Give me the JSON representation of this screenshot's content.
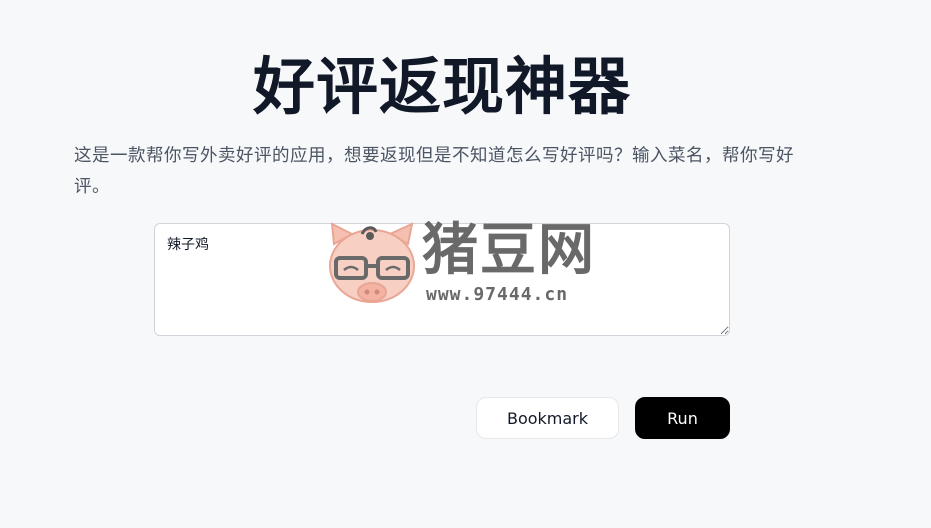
{
  "header": {
    "title": "好评返现神器"
  },
  "main": {
    "description": "这是一款帮你写外卖好评的应用，想要返现但是不知道怎么写好评吗？输入菜名，帮你写好评。",
    "dish_input": {
      "value": "辣子鸡"
    },
    "actions": {
      "bookmark_label": "Bookmark",
      "run_label": "Run"
    }
  },
  "watermark": {
    "brand_text": "猪豆网",
    "url_text": "www.97444.cn"
  },
  "colors": {
    "background": "#f7f8fa",
    "title": "#111827",
    "run_button": "#000000",
    "watermark_pig": "#f4b8a8",
    "watermark_text": "#555555"
  }
}
